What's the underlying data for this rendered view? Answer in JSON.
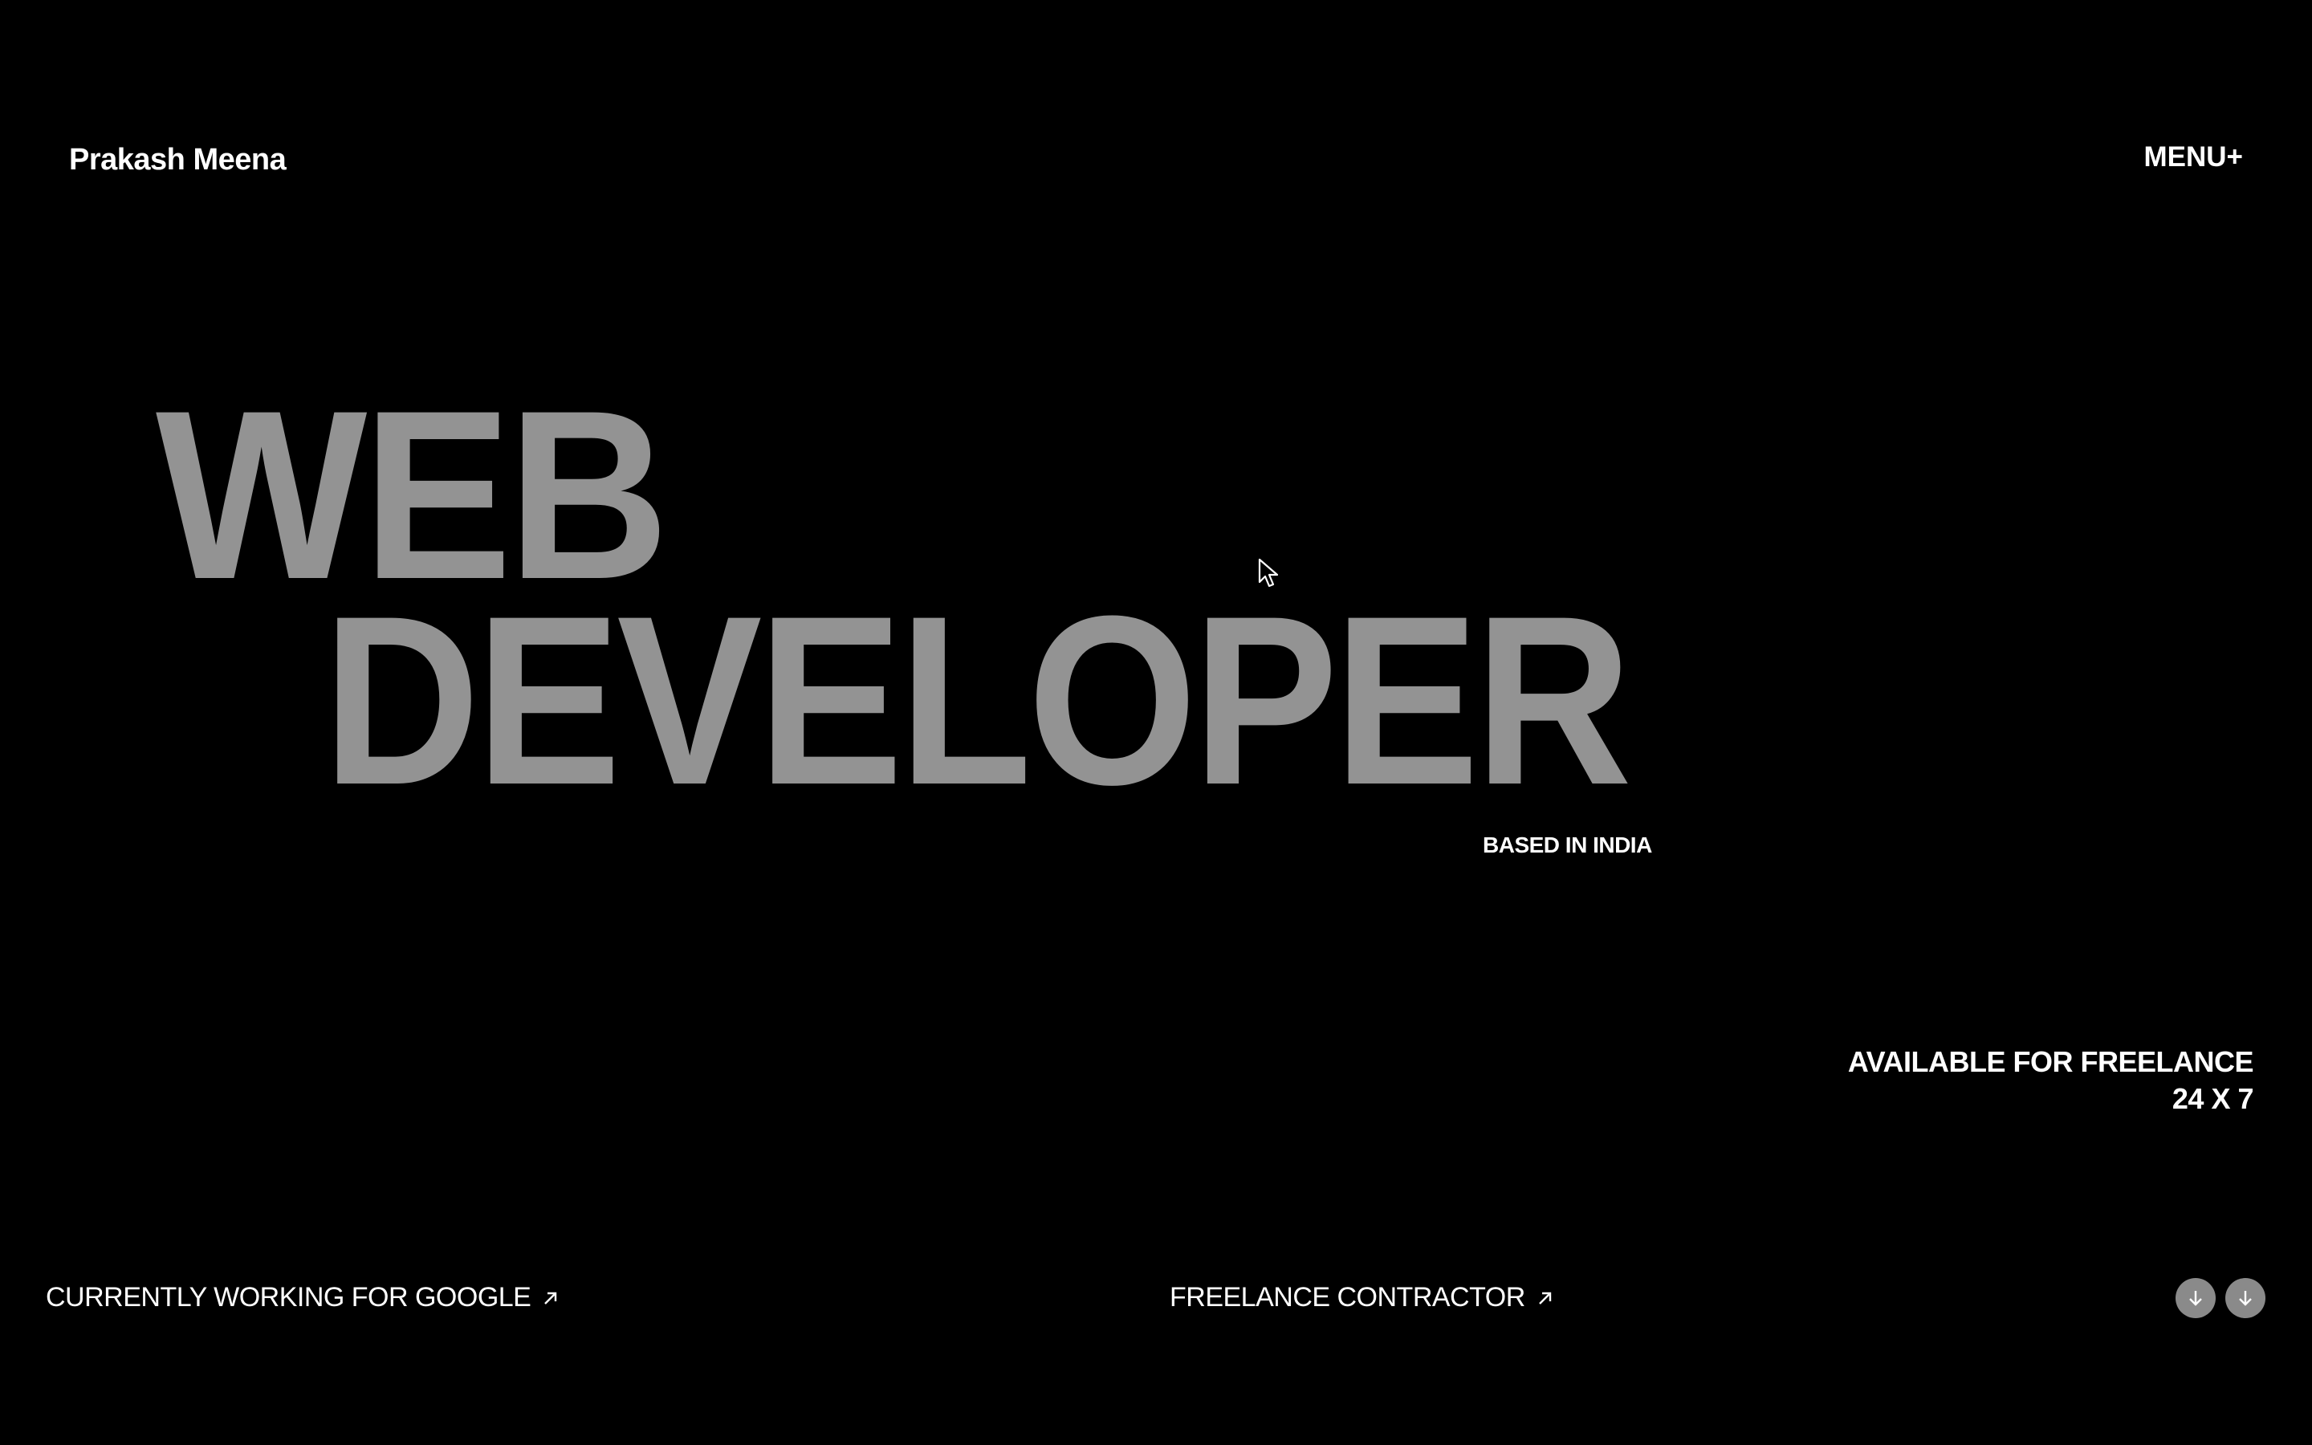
{
  "header": {
    "brand_name": "Prakash Meena",
    "menu_label": "MENU+"
  },
  "hero": {
    "line1": "WEB",
    "line2": "DEVELOPER",
    "location": "BASED IN INDIA"
  },
  "availability": {
    "line1": "AVAILABLE FOR FREELANCE",
    "line2": "24 X 7"
  },
  "footer": {
    "left_link": "CURRENTLY WORKING FOR GOOGLE",
    "center_link": "FREELANCE CONTRACTOR",
    "link_icon": "arrow-up-right-icon",
    "scroll_icon": "arrow-down-icon"
  },
  "colors": {
    "background": "#000000",
    "foreground": "#ffffff",
    "hero_text": "#939393",
    "scroll_button": "#8a8a8a"
  }
}
